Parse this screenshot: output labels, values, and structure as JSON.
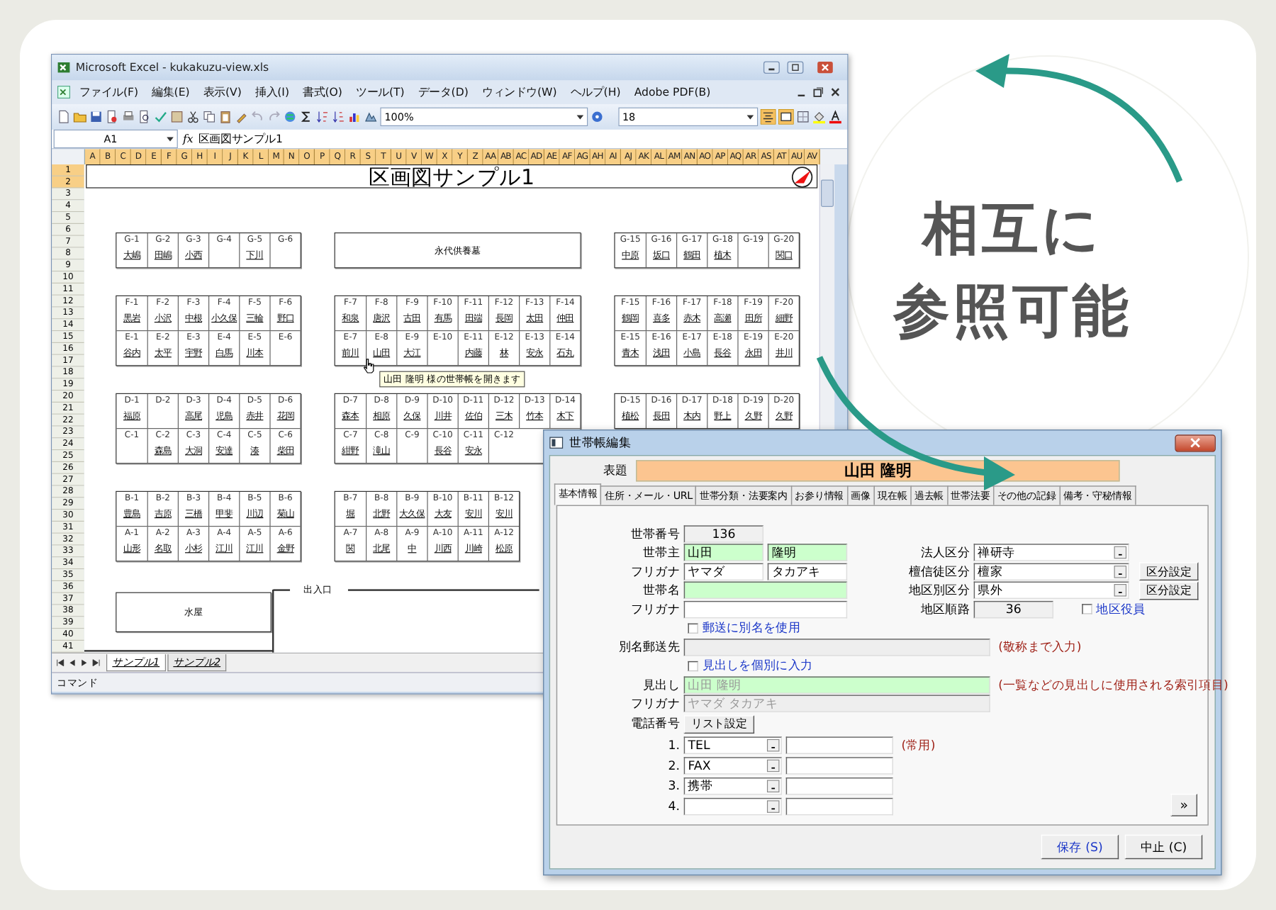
{
  "excel": {
    "title": "Microsoft Excel - kukakuzu-view.xls",
    "menu": [
      "ファイル(F)",
      "編集(E)",
      "表示(V)",
      "挿入(I)",
      "書式(O)",
      "ツール(T)",
      "データ(D)",
      "ウィンドウ(W)",
      "ヘルプ(H)",
      "Adobe PDF(B)"
    ],
    "zoom": "100%",
    "font_size": "18",
    "name_box": "A1",
    "function_label": "fx",
    "formula": "区画図サンプル1",
    "columns": [
      {
        "label": "A",
        "selected": true
      },
      {
        "label": "B",
        "selected": true
      },
      {
        "label": "C",
        "selected": true
      },
      {
        "label": "D",
        "selected": true
      },
      {
        "label": "E",
        "selected": true
      },
      {
        "label": "F",
        "selected": true
      },
      {
        "label": "G",
        "selected": true
      },
      {
        "label": "H",
        "selected": true
      },
      {
        "label": "I",
        "selected": true
      },
      {
        "label": "J",
        "selected": true
      },
      {
        "label": "K",
        "selected": true
      },
      {
        "label": "L",
        "selected": true
      },
      {
        "label": "M",
        "selected": true
      },
      {
        "label": "N",
        "selected": true
      },
      {
        "label": "O",
        "selected": true
      },
      {
        "label": "P",
        "selected": true
      },
      {
        "label": "Q",
        "selected": true
      },
      {
        "label": "R",
        "selected": true
      },
      {
        "label": "S",
        "selected": true
      },
      {
        "label": "T",
        "selected": true
      },
      {
        "label": "U",
        "selected": true
      },
      {
        "label": "V",
        "selected": true
      },
      {
        "label": "W",
        "selected": true
      },
      {
        "label": "X",
        "selected": true
      },
      {
        "label": "Y",
        "selected": true
      },
      {
        "label": "Z",
        "selected": true
      },
      {
        "label": "AA",
        "selected": true
      },
      {
        "label": "AB",
        "selected": true
      },
      {
        "label": "AC",
        "selected": true
      },
      {
        "label": "AD",
        "selected": true
      },
      {
        "label": "AE",
        "selected": true
      },
      {
        "label": "AF",
        "selected": true
      },
      {
        "label": "AG",
        "selected": true
      },
      {
        "label": "AH",
        "selected": true
      },
      {
        "label": "AI",
        "selected": true
      },
      {
        "label": "AJ",
        "selected": true
      },
      {
        "label": "AK",
        "selected": true
      },
      {
        "label": "AL",
        "selected": true
      },
      {
        "label": "AM",
        "selected": true
      },
      {
        "label": "AN",
        "selected": true
      },
      {
        "label": "AO",
        "selected": true
      },
      {
        "label": "AP",
        "selected": true
      },
      {
        "label": "AQ",
        "selected": true
      },
      {
        "label": "AR",
        "selected": true
      },
      {
        "label": "AS",
        "selected": true
      },
      {
        "label": "AT",
        "selected": true
      },
      {
        "label": "AU",
        "selected": true
      },
      {
        "label": "AV",
        "selected": true
      }
    ],
    "rows": [
      {
        "label": "1",
        "selected": true
      },
      {
        "label": "2",
        "selected": true
      },
      {
        "label": "3",
        "selected": false
      },
      {
        "label": "4",
        "selected": false
      },
      {
        "label": "5",
        "selected": false
      },
      {
        "label": "6",
        "selected": false
      },
      {
        "label": "7",
        "selected": false
      },
      {
        "label": "8",
        "selected": false
      },
      {
        "label": "9",
        "selected": false
      },
      {
        "label": "10",
        "selected": false
      },
      {
        "label": "11",
        "selected": false
      },
      {
        "label": "12",
        "selected": false
      },
      {
        "label": "13",
        "selected": false
      },
      {
        "label": "14",
        "selected": false
      },
      {
        "label": "15",
        "selected": false
      },
      {
        "label": "16",
        "selected": false
      },
      {
        "label": "17",
        "selected": false
      },
      {
        "label": "18",
        "selected": false
      },
      {
        "label": "19",
        "selected": false
      },
      {
        "label": "20",
        "selected": false
      },
      {
        "label": "21",
        "selected": false
      },
      {
        "label": "22",
        "selected": false
      },
      {
        "label": "23",
        "selected": false
      },
      {
        "label": "24",
        "selected": false
      },
      {
        "label": "25",
        "selected": false
      },
      {
        "label": "26",
        "selected": false
      },
      {
        "label": "27",
        "selected": false
      },
      {
        "label": "28",
        "selected": false
      },
      {
        "label": "29",
        "selected": false
      },
      {
        "label": "30",
        "selected": false
      },
      {
        "label": "31",
        "selected": false
      },
      {
        "label": "32",
        "selected": false
      },
      {
        "label": "33",
        "selected": false
      },
      {
        "label": "34",
        "selected": false
      },
      {
        "label": "35",
        "selected": false
      },
      {
        "label": "36",
        "selected": false
      },
      {
        "label": "37",
        "selected": false
      },
      {
        "label": "38",
        "selected": false
      },
      {
        "label": "39",
        "selected": false
      },
      {
        "label": "40",
        "selected": false
      },
      {
        "label": "41",
        "selected": false
      }
    ],
    "sheet_title": "区画図サンプル1",
    "bands": [
      {
        "groups": [
          {
            "kind": "plots",
            "rows": [
              [
                {
                  "code": "G-1",
                  "name": "大嶋"
                },
                {
                  "code": "G-2",
                  "name": "田嶋"
                },
                {
                  "code": "G-3",
                  "name": "小西"
                },
                {
                  "code": "G-4"
                },
                {
                  "code": "G-5",
                  "name": "下川"
                },
                {
                  "code": "G-6"
                }
              ]
            ]
          },
          {
            "kind": "label",
            "text": "永代供養墓"
          },
          {
            "kind": "plots",
            "rows": [
              [
                {
                  "code": "G-15",
                  "name": "中原"
                },
                {
                  "code": "G-16",
                  "name": "坂口"
                },
                {
                  "code": "G-17",
                  "name": "鶴田"
                },
                {
                  "code": "G-18",
                  "name": "植木"
                },
                {
                  "code": "G-19"
                },
                {
                  "code": "G-20",
                  "name": "関口"
                }
              ]
            ]
          }
        ]
      },
      {
        "groups": [
          {
            "kind": "plots",
            "rows": [
              [
                {
                  "code": "F-1",
                  "name": "黒岩"
                },
                {
                  "code": "F-2",
                  "name": "小沢"
                },
                {
                  "code": "F-3",
                  "name": "中根"
                },
                {
                  "code": "F-4",
                  "name": "小久保"
                },
                {
                  "code": "F-5",
                  "name": "三輪"
                },
                {
                  "code": "F-6",
                  "name": "野口"
                }
              ],
              [
                {
                  "code": "E-1",
                  "name": "谷内"
                },
                {
                  "code": "E-2",
                  "name": "太平"
                },
                {
                  "code": "E-3",
                  "name": "宇野"
                },
                {
                  "code": "E-4",
                  "name": "白馬"
                },
                {
                  "code": "E-5",
                  "name": "川本"
                },
                {
                  "code": "E-6"
                }
              ]
            ]
          },
          {
            "kind": "plots",
            "rows": [
              [
                {
                  "code": "F-7",
                  "name": "和泉"
                },
                {
                  "code": "F-8",
                  "name": "唐沢"
                },
                {
                  "code": "F-9",
                  "name": "古田"
                },
                {
                  "code": "F-10",
                  "name": "有馬"
                },
                {
                  "code": "F-11",
                  "name": "田端"
                },
                {
                  "code": "F-12",
                  "name": "長岡"
                },
                {
                  "code": "F-13",
                  "name": "太田"
                },
                {
                  "code": "F-14",
                  "name": "仲田"
                }
              ],
              [
                {
                  "code": "E-7",
                  "name": "前川"
                },
                {
                  "code": "E-8",
                  "name": "山田"
                },
                {
                  "code": "E-9",
                  "name": "大江"
                },
                {
                  "code": "E-10"
                },
                {
                  "code": "E-11",
                  "name": "内藤"
                },
                {
                  "code": "E-12",
                  "name": "林"
                },
                {
                  "code": "E-13",
                  "name": "安永"
                },
                {
                  "code": "E-14",
                  "name": "石丸"
                }
              ]
            ]
          },
          {
            "kind": "plots",
            "rows": [
              [
                {
                  "code": "F-15",
                  "name": "鶴岡"
                },
                {
                  "code": "F-16",
                  "name": "喜多"
                },
                {
                  "code": "F-17",
                  "name": "赤木"
                },
                {
                  "code": "F-18",
                  "name": "高瀬"
                },
                {
                  "code": "F-19",
                  "name": "田所"
                },
                {
                  "code": "F-20",
                  "name": "細野"
                }
              ],
              [
                {
                  "code": "E-15",
                  "name": "青木"
                },
                {
                  "code": "E-16",
                  "name": "浅田"
                },
                {
                  "code": "E-17",
                  "name": "小島"
                },
                {
                  "code": "E-18",
                  "name": "長谷"
                },
                {
                  "code": "E-19",
                  "name": "永田"
                },
                {
                  "code": "E-20",
                  "name": "井川"
                }
              ]
            ]
          }
        ]
      },
      {
        "groups": [
          {
            "kind": "plots",
            "rows": [
              [
                {
                  "code": "D-1",
                  "name": "福原"
                },
                {
                  "code": "D-2"
                },
                {
                  "code": "D-3",
                  "name": "高尾"
                },
                {
                  "code": "D-4",
                  "name": "児島"
                },
                {
                  "code": "D-5",
                  "name": "赤井"
                },
                {
                  "code": "D-6",
                  "name": "花岡"
                }
              ],
              [
                {
                  "code": "C-1"
                },
                {
                  "code": "C-2",
                  "name": "森島"
                },
                {
                  "code": "C-3",
                  "name": "大洞"
                },
                {
                  "code": "C-4",
                  "name": "安達"
                },
                {
                  "code": "C-5",
                  "name": "湊"
                },
                {
                  "code": "C-6",
                  "name": "柴田"
                }
              ]
            ]
          },
          {
            "kind": "plots",
            "rows": [
              [
                {
                  "code": "D-7",
                  "name": "森本"
                },
                {
                  "code": "D-8",
                  "name": "相原"
                },
                {
                  "code": "D-9",
                  "name": "久保"
                },
                {
                  "code": "D-10",
                  "name": "川井"
                },
                {
                  "code": "D-11",
                  "name": "佐伯"
                },
                {
                  "code": "D-12",
                  "name": "三木"
                },
                {
                  "code": "D-13",
                  "name": "竹本"
                },
                {
                  "code": "D-14",
                  "name": "木下"
                }
              ],
              [
                {
                  "code": "C-7",
                  "name": "紺野"
                },
                {
                  "code": "C-8",
                  "name": "滝山"
                },
                {
                  "code": "C-9"
                },
                {
                  "code": "C-10",
                  "name": "長谷"
                },
                {
                  "code": "C-11",
                  "name": "安永"
                },
                {
                  "code": "C-12"
                }
              ]
            ]
          },
          {
            "kind": "plots",
            "rows": [
              [
                {
                  "code": "D-15",
                  "name": "植松"
                },
                {
                  "code": "D-16",
                  "name": "長田"
                },
                {
                  "code": "D-17",
                  "name": "木内"
                },
                {
                  "code": "D-18",
                  "name": "野上"
                },
                {
                  "code": "D-19",
                  "name": "久野"
                },
                {
                  "code": "D-20",
                  "name": "久野"
                }
              ]
            ]
          }
        ]
      },
      {
        "groups": [
          {
            "kind": "plots",
            "rows": [
              [
                {
                  "code": "B-1",
                  "name": "豊島"
                },
                {
                  "code": "B-2",
                  "name": "吉原"
                },
                {
                  "code": "B-3",
                  "name": "三橋"
                },
                {
                  "code": "B-4",
                  "name": "甲斐"
                },
                {
                  "code": "B-5",
                  "name": "川辺"
                },
                {
                  "code": "B-6",
                  "name": "菊山"
                }
              ],
              [
                {
                  "code": "A-1",
                  "name": "山形"
                },
                {
                  "code": "A-2",
                  "name": "名取"
                },
                {
                  "code": "A-3",
                  "name": "小杉"
                },
                {
                  "code": "A-4",
                  "name": "江川"
                },
                {
                  "code": "A-5",
                  "name": "江川"
                },
                {
                  "code": "A-6",
                  "name": "金野"
                }
              ]
            ]
          },
          {
            "kind": "plots",
            "rows": [
              [
                {
                  "code": "B-7",
                  "name": "堀"
                },
                {
                  "code": "B-8",
                  "name": "北野"
                },
                {
                  "code": "B-9",
                  "name": "大久保"
                },
                {
                  "code": "B-10",
                  "name": "大友"
                },
                {
                  "code": "B-11",
                  "name": "安川"
                },
                {
                  "code": "B-12",
                  "name": "安川"
                }
              ],
              [
                {
                  "code": "A-7",
                  "name": "関"
                },
                {
                  "code": "A-8",
                  "name": "北尾"
                },
                {
                  "code": "A-9",
                  "name": "中"
                },
                {
                  "code": "A-10",
                  "name": "川西"
                },
                {
                  "code": "A-11",
                  "name": "川崎"
                },
                {
                  "code": "A-12",
                  "name": "松原"
                }
              ]
            ]
          }
        ]
      }
    ],
    "water_station": "水屋",
    "entrance": "出入口",
    "tooltip": "山田 隆明 様の世帯帳を開きます",
    "sheet_tabs": [
      {
        "label": "サンプル1",
        "selected": true
      },
      {
        "label": "サンプル2",
        "selected": false
      }
    ],
    "status": "コマンド"
  },
  "callout": {
    "lines": [
      "相互に",
      "参照可能"
    ]
  },
  "dialog": {
    "title": "世帯帳編集",
    "heading_label": "表題",
    "heading_value": "山田 隆明",
    "tabs": [
      {
        "label": "基本情報",
        "selected": true
      },
      {
        "label": "住所・メール・URL",
        "selected": false
      },
      {
        "label": "世帯分類・法要案内",
        "selected": false
      },
      {
        "label": "お参り情報",
        "selected": false
      },
      {
        "label": "画像",
        "selected": false
      },
      {
        "label": "現在帳",
        "selected": false
      },
      {
        "label": "過去帳",
        "selected": false
      },
      {
        "label": "世帯法要",
        "selected": false
      },
      {
        "label": "その他の記録",
        "selected": false
      },
      {
        "label": "備考・守秘情報",
        "selected": false
      }
    ],
    "household_no": {
      "label": "世帯番号",
      "value": "136"
    },
    "head": {
      "label": "世帯主",
      "surname": "山田",
      "given": "隆明"
    },
    "head_kana": {
      "label": "フリガナ",
      "surname": "ヤマダ",
      "given": "タカアキ"
    },
    "household_name": {
      "label": "世帯名"
    },
    "household_name_kana": {
      "label": "フリガナ"
    },
    "corporate_class": {
      "label": "法人区分",
      "value": "禅研寺"
    },
    "member_class": {
      "label": "檀信徒区分",
      "value": "檀家",
      "button": "区分設定"
    },
    "district_class": {
      "label": "地区別区分",
      "value": "県外",
      "button": "区分設定"
    },
    "route": {
      "label": "地区順路",
      "value": "36"
    },
    "district_officer": {
      "label": "地区役員",
      "checked": false
    },
    "use_alias": {
      "label": "郵送に別名を使用",
      "checked": false
    },
    "alias_address": {
      "label": "別名郵送先",
      "note": "(敬称まで入力)",
      "disabled": true
    },
    "custom_heading": {
      "label": "見出しを個別に入力",
      "checked": false
    },
    "heading": {
      "label": "見出し",
      "value": "山田 隆明",
      "note": "(一覧などの見出しに使用される索引項目)",
      "disabled": true
    },
    "heading_kana": {
      "label": "フリガナ",
      "value": "ヤマダ タカアキ",
      "disabled": true
    },
    "phones": {
      "label": "電話番号",
      "button": "リスト設定",
      "rows": [
        {
          "index": "1.",
          "type": "TEL",
          "note": "(常用)"
        },
        {
          "index": "2.",
          "type": "FAX"
        },
        {
          "index": "3.",
          "type": "携帯"
        },
        {
          "index": "4."
        }
      ]
    },
    "more_button": "»",
    "buttons": [
      {
        "label": "保存 (S)",
        "default": true
      },
      {
        "label": "中止 (C)",
        "default": false
      }
    ]
  }
}
